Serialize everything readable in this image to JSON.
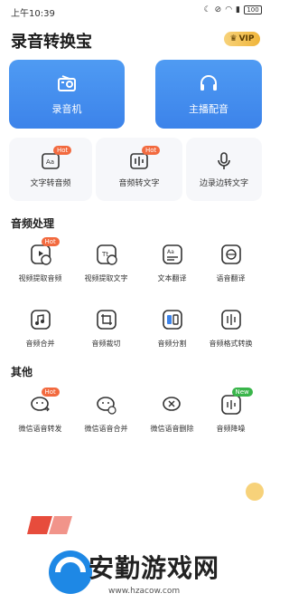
{
  "status_bar": {
    "time": "上午10:39",
    "battery": "100"
  },
  "header": {
    "title": "录音转换宝",
    "vip_label": "VIP"
  },
  "big_cards": [
    {
      "label": "录音机",
      "icon": "radio-icon"
    },
    {
      "label": "主播配音",
      "icon": "headphones-icon"
    }
  ],
  "small_cards": [
    {
      "label": "文字转音频",
      "badge": "Hot",
      "icon": "text-to-audio-icon"
    },
    {
      "label": "音频转文字",
      "badge": "Hot",
      "icon": "audio-to-text-icon"
    },
    {
      "label": "边录边转文字",
      "badge": "",
      "icon": "microphone-icon"
    }
  ],
  "sections": {
    "audio_processing": "音频处理",
    "other": "其他"
  },
  "audio_processing_items": [
    {
      "label": "视频提取音频",
      "badge": "Hot",
      "icon": "video-extract-audio-icon"
    },
    {
      "label": "视频提取文字",
      "badge": "",
      "icon": "video-extract-text-icon"
    },
    {
      "label": "文本翻译",
      "badge": "",
      "icon": "text-translate-icon"
    },
    {
      "label": "语音翻译",
      "badge": "",
      "icon": "voice-translate-icon"
    },
    {
      "label": "音频合并",
      "badge": "",
      "icon": "audio-merge-icon"
    },
    {
      "label": "音频裁切",
      "badge": "",
      "icon": "audio-crop-icon"
    },
    {
      "label": "音频分割",
      "badge": "",
      "icon": "audio-split-icon"
    },
    {
      "label": "音频格式转换",
      "badge": "",
      "icon": "audio-format-convert-icon"
    }
  ],
  "other_items": [
    {
      "label": "微信语音转发",
      "badge": "Hot",
      "icon": "wechat-voice-forward-icon"
    },
    {
      "label": "微信语音合并",
      "badge": "",
      "icon": "wechat-voice-merge-icon"
    },
    {
      "label": "微信语音删除",
      "badge": "",
      "icon": "wechat-voice-delete-icon"
    },
    {
      "label": "音频降噪",
      "badge": "New",
      "icon": "audio-denoise-icon"
    }
  ],
  "watermark": {
    "text": "安勤游戏网",
    "url": "www.hzacow.com"
  },
  "colors": {
    "primary": "#3c83ea",
    "hot_badge": "#f26a3f",
    "new_badge": "#39b54a",
    "vip": "#f0b53a"
  }
}
